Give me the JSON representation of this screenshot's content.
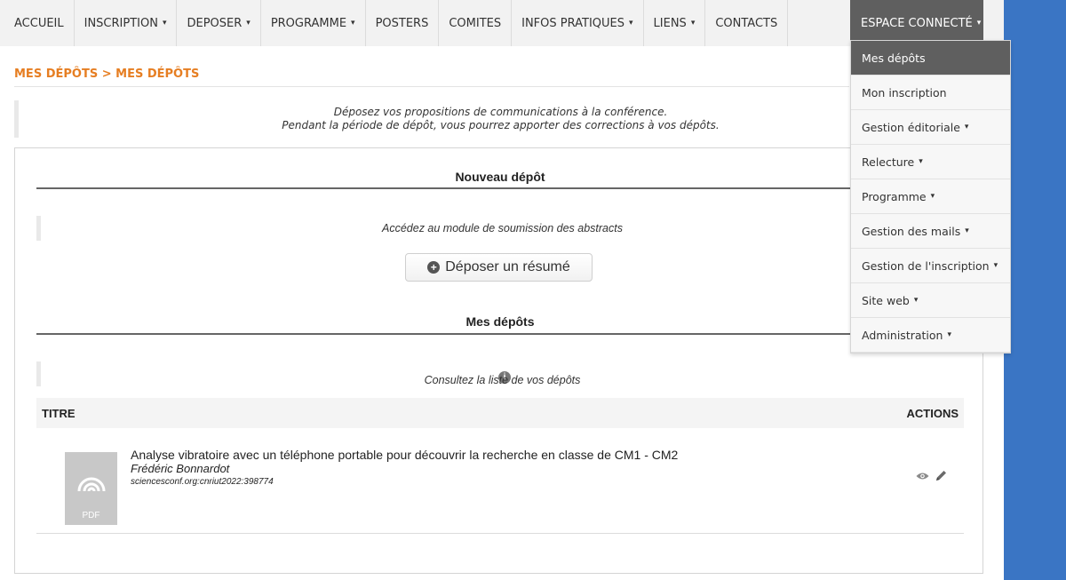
{
  "nav": {
    "items": [
      {
        "label": "ACCUEIL",
        "dropdown": false
      },
      {
        "label": "INSCRIPTION",
        "dropdown": true
      },
      {
        "label": "DEPOSER",
        "dropdown": true
      },
      {
        "label": "PROGRAMME",
        "dropdown": true
      },
      {
        "label": "POSTERS",
        "dropdown": false
      },
      {
        "label": "COMITES",
        "dropdown": false
      },
      {
        "label": "INFOS PRATIQUES",
        "dropdown": true
      },
      {
        "label": "LIENS",
        "dropdown": true
      },
      {
        "label": "CONTACTS",
        "dropdown": false
      }
    ],
    "espace_label": "ESPACE CONNECTÉ",
    "caret": "▾"
  },
  "dropdown": {
    "items": [
      {
        "label": "Mes dépôts",
        "active": true
      },
      {
        "label": "Mon inscription"
      },
      {
        "label": "Gestion éditoriale",
        "caret": "▾"
      },
      {
        "label": "Relecture",
        "caret": "▾"
      },
      {
        "label": "Programme",
        "caret": "▾"
      },
      {
        "label": "Gestion des mails",
        "caret": "▾"
      },
      {
        "label": "Gestion de l'inscription",
        "caret": "▾"
      },
      {
        "label": "Site web",
        "caret": "▾"
      },
      {
        "label": "Administration",
        "caret": "▾"
      }
    ]
  },
  "breadcrumb": "MES DÉPÔTS > MES DÉPÔTS",
  "intro": {
    "line1": "Déposez vos propositions de communications à la conférence.",
    "line2": "Pendant la période de dépôt, vous pourrez apporter des corrections à vos dépôts."
  },
  "new_deposit": {
    "title": "Nouveau dépôt",
    "note": "Accédez au module de soumission des abstracts",
    "button_label": "Déposer un résumé"
  },
  "my_deposits": {
    "title": "Mes dépôts",
    "note": "Consultez la liste de vos dépôts",
    "columns": {
      "title": "TITRE",
      "actions": "ACTIONS"
    },
    "rows": [
      {
        "title": "Analyse vibratoire avec un téléphone portable pour découvrir la recherche en classe de CM1 - CM2",
        "author": "Frédéric Bonnardot",
        "ref": "sciencesconf.org:cnriut2022:398774",
        "file_label": "PDF"
      }
    ]
  },
  "colors": {
    "accent": "#e67e22",
    "nav_bg": "#f2f2f2",
    "active_bg": "#5f5f5f",
    "side_band": "#3a75c4"
  }
}
